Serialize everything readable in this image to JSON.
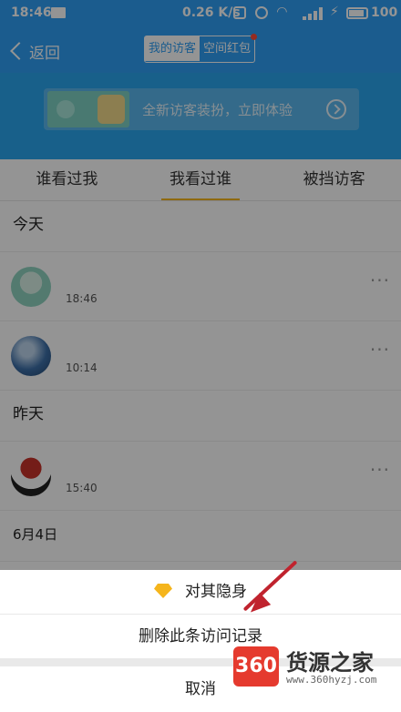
{
  "status_bar": {
    "time": "18:46",
    "speed": "0.26 K/s",
    "battery": "100"
  },
  "header": {
    "back_label": "返回",
    "segments": [
      "我的访客",
      "空间红包"
    ]
  },
  "banner": {
    "text": "全新访客装扮，立即体验"
  },
  "tabs": [
    "谁看过我",
    "我看过谁",
    "被挡访客"
  ],
  "list": {
    "today_label": "今天",
    "today_rows": [
      {
        "time": "18:46"
      },
      {
        "time": "10:14"
      }
    ],
    "yesterday_label": "昨天",
    "yesterday_rows": [
      {
        "time": "15:40"
      }
    ],
    "date_label": "6月4日",
    "more_glyph": "···"
  },
  "action_sheet": {
    "hide_label": "对其隐身",
    "delete_label": "删除此条访问记录",
    "cancel_label": "取消"
  },
  "watermark": {
    "logo": "360",
    "title": "货源之家",
    "url": "www.360hyzj.com"
  },
  "colors": {
    "brand_blue": "#2f9ff5",
    "accent_yellow": "#f5b51c",
    "arrow_red": "#c0232e"
  }
}
